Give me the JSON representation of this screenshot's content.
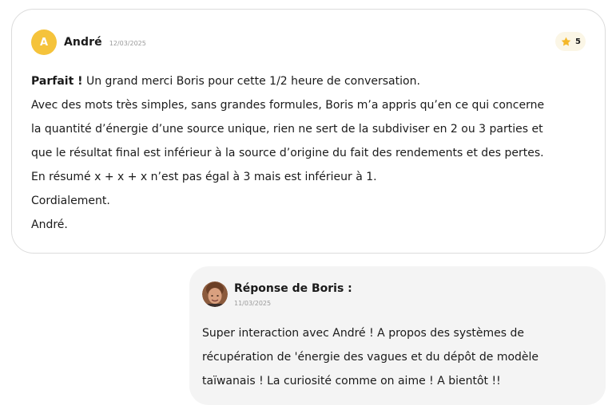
{
  "review": {
    "avatar_letter": "A",
    "author": "André",
    "date": "12/03/2025",
    "rating": "5",
    "rating_icon": "star-icon",
    "lines": [
      {
        "bold": "Parfait !",
        "text": " Un grand merci Boris pour cette 1/2 heure de conversation."
      },
      {
        "bold": "",
        "text": "Avec des mots très simples, sans grandes formules, Boris m’a appris qu’en ce qui concerne"
      },
      {
        "bold": "",
        "text": "la quantité d’énergie d’une source unique, rien ne sert de la subdiviser en 2 ou 3 parties et"
      },
      {
        "bold": "",
        "text": "que le résultat final est inférieur à la source d’origine du fait des rendements et des pertes."
      },
      {
        "bold": "",
        "text": "En résumé x + x + x n’est pas égal à 3 mais est inférieur à 1."
      },
      {
        "bold": "",
        "text": "Cordialement."
      },
      {
        "bold": "",
        "text": "André."
      }
    ]
  },
  "reply": {
    "title": "Réponse de Boris :",
    "date": "11/03/2025",
    "lines": [
      "Super interaction avec André ! A propos des systèmes de",
      "récupération de 'énergie des vagues et du dépôt de modèle",
      "taïwanais ! La curiosité comme on aime ! A bientôt !!"
    ]
  },
  "colors": {
    "avatar_bg": "#f5c33b",
    "star": "#f4b728",
    "rating_badge_bg": "#fbf6e6",
    "reply_bg": "#f4f4f4",
    "card_border": "#dcdcdc",
    "date_text": "#9a9a9a"
  }
}
